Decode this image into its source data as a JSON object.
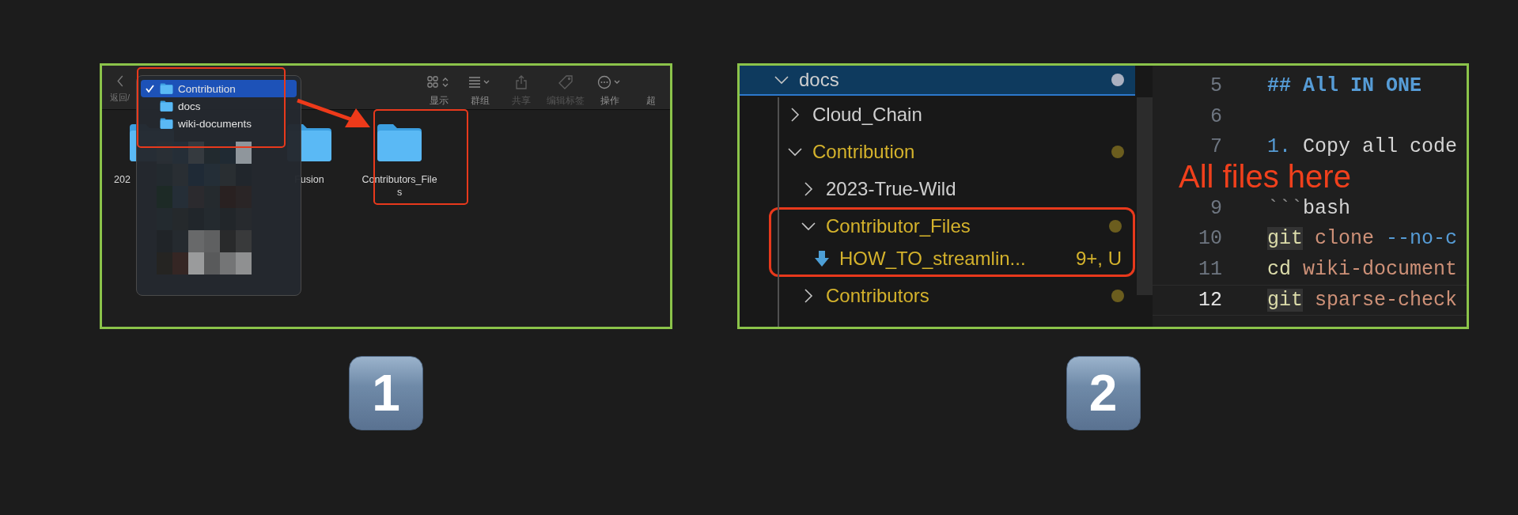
{
  "panels": [
    {
      "kind": "finder",
      "step": "1",
      "toolbar": {
        "back_label": "返回/",
        "items": [
          {
            "kind": "view",
            "label": "显示",
            "disabled": false
          },
          {
            "kind": "group",
            "label": "群组",
            "disabled": false
          },
          {
            "kind": "share",
            "label": "共享",
            "disabled": true
          },
          {
            "kind": "tag",
            "label": "编辑标签",
            "disabled": true
          },
          {
            "kind": "action",
            "label": "操作",
            "disabled": false
          },
          {
            "kind": "more",
            "label": "超",
            "disabled": false
          }
        ]
      },
      "folders": [
        {
          "label": "202"
        },
        {
          "label": "Fusion"
        },
        {
          "label": "Contributors_Files"
        }
      ],
      "path_menu": [
        {
          "label": "Contribution",
          "selected": true
        },
        {
          "label": "docs",
          "selected": false
        },
        {
          "label": "wiki-documents",
          "selected": false
        }
      ]
    },
    {
      "kind": "editor",
      "step": "2",
      "annotation": "All files here",
      "tree": [
        {
          "kind": "folder",
          "label": "docs",
          "expanded": true,
          "selected": true,
          "modified": true,
          "children": [
            {
              "kind": "folder",
              "label": "Cloud_Chain",
              "expanded": false,
              "selected": false,
              "modified": false
            },
            {
              "kind": "folder",
              "label": "Contribution",
              "expanded": true,
              "selected": false,
              "modified": true,
              "children": [
                {
                  "kind": "folder",
                  "label": "2023-True-Wild",
                  "expanded": false,
                  "selected": false,
                  "modified": false
                },
                {
                  "kind": "folder",
                  "label": "Contributor_Files",
                  "expanded": true,
                  "selected": false,
                  "modified": true,
                  "highlighted": true,
                  "children": [
                    {
                      "kind": "file",
                      "label": "HOW_TO_streamlin...",
                      "badge": "9+, U",
                      "selected": false,
                      "modified": true
                    }
                  ]
                },
                {
                  "kind": "folder",
                  "label": "Contributors",
                  "expanded": false,
                  "selected": false,
                  "modified": true
                }
              ]
            }
          ]
        }
      ],
      "lines": [
        {
          "number": "5",
          "current": false,
          "tokens": [
            {
              "kind": "heading",
              "text": "## All IN ONE"
            }
          ]
        },
        {
          "number": "6",
          "current": false
        },
        {
          "number": "7",
          "current": false,
          "tokens": [
            {
              "kind": "number",
              "text": "1."
            },
            {
              "kind": "text",
              "text": "Copy all code"
            }
          ]
        },
        {
          "current": false
        },
        {
          "number": "9",
          "current": false,
          "tokens": [
            {
              "kind": "fence",
              "text": "```"
            },
            {
              "kind": "text",
              "text": "bash"
            }
          ]
        },
        {
          "number": "10",
          "current": false,
          "tokens": [
            {
              "kind": "command",
              "text": "git"
            },
            {
              "kind": "string",
              "text": "clone"
            },
            {
              "kind": "flag",
              "text": "--no-c"
            }
          ]
        },
        {
          "number": "11",
          "current": false,
          "tokens": [
            {
              "kind": "keyword",
              "text": "cd"
            },
            {
              "kind": "string",
              "text": "wiki-document"
            }
          ]
        },
        {
          "number": "12",
          "current": true,
          "tokens": [
            {
              "kind": "command",
              "text": "git"
            },
            {
              "kind": "string",
              "text": "sparse-check"
            }
          ]
        }
      ]
    }
  ]
}
